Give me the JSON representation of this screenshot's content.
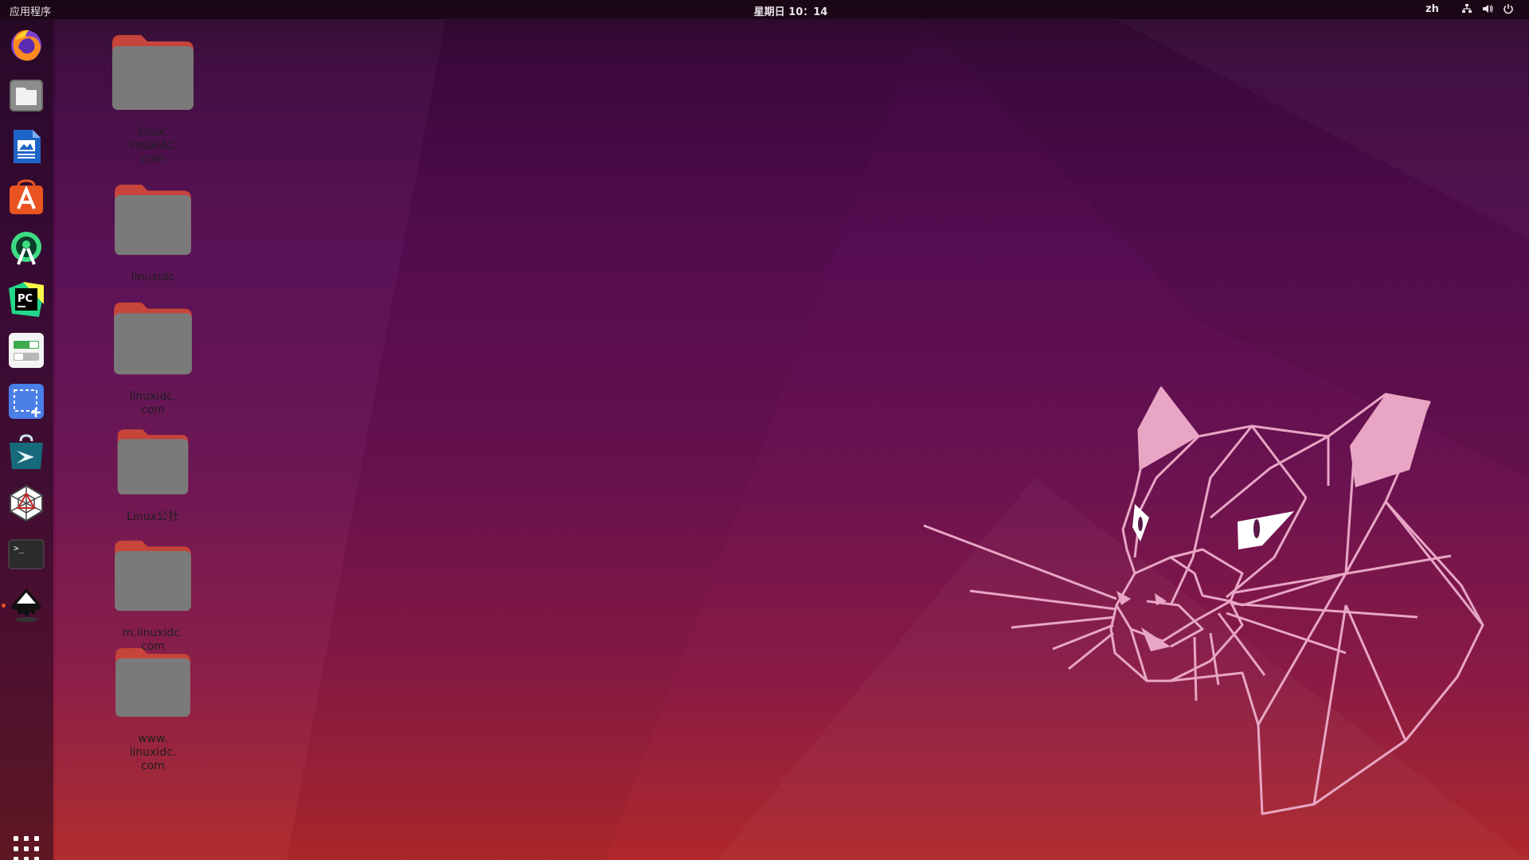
{
  "topbar": {
    "activities_label": "应用程序",
    "clock": "星期日 10：14",
    "input_language": "zh",
    "tray_icons": [
      "network-icon",
      "volume-icon",
      "power-icon"
    ]
  },
  "dock": {
    "items": [
      {
        "name": "firefox",
        "icon": "firefox-icon"
      },
      {
        "name": "files",
        "icon": "files-icon"
      },
      {
        "name": "libreoffice-writer",
        "icon": "writer-icon"
      },
      {
        "name": "ubuntu-software",
        "icon": "software-center-icon"
      },
      {
        "name": "android-studio",
        "icon": "android-studio-icon"
      },
      {
        "name": "pycharm",
        "icon": "pycharm-icon"
      },
      {
        "name": "settings-toggles",
        "icon": "toggles-icon"
      },
      {
        "name": "screenshot",
        "icon": "screenshot-icon"
      },
      {
        "name": "software-store",
        "icon": "store-bag-icon"
      },
      {
        "name": "network-tool",
        "icon": "spiderweb-icon"
      },
      {
        "name": "terminal",
        "icon": "terminal-icon"
      },
      {
        "name": "inkscape",
        "icon": "inkscape-icon",
        "running": true
      }
    ],
    "show_apps": "apps-grid-icon"
  },
  "desktop_icons": [
    {
      "label": "linux.\nlinuxidc.\ncom"
    },
    {
      "label": "linuxidc"
    },
    {
      "label": "linuxidc.\ncom"
    },
    {
      "label": "Linux公社"
    },
    {
      "label": "m.linuxidc.\ncom"
    },
    {
      "label": "www.\nlinuxidc.\ncom"
    }
  ],
  "colors": {
    "accent": "#e95420",
    "folder_body": "#7a7a7a",
    "folder_tab": "#c6443a"
  }
}
